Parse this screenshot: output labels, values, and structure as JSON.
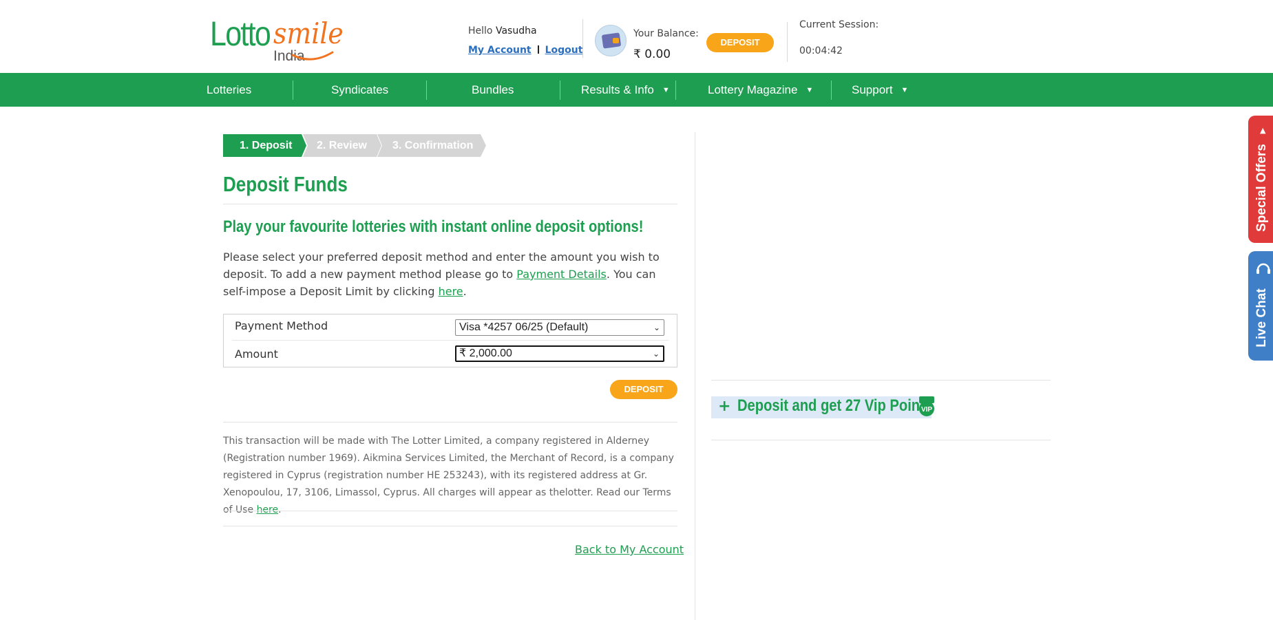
{
  "header": {
    "logo": {
      "part1": "Lotto",
      "part2": "smile",
      "part3": "India"
    },
    "greeting_prefix": "Hello",
    "username": "Vasudha",
    "my_account": "My Account",
    "logout": "Logout",
    "balance_label": "Your Balance:",
    "balance_value": "₹ 0.00",
    "deposit_button": "DEPOSIT",
    "session_label": "Current Session:",
    "session_time": "00:04:42"
  },
  "nav": {
    "items": [
      {
        "label": "Lotteries"
      },
      {
        "label": "Syndicates"
      },
      {
        "label": "Bundles"
      },
      {
        "label": "Results & Info",
        "arrow": "▼"
      },
      {
        "label": "Lottery Magazine",
        "arrow": "▼"
      },
      {
        "label": "Support",
        "arrow": "▼"
      }
    ]
  },
  "steps": [
    "1. Deposit",
    "2. Review",
    "3. Confirmation"
  ],
  "main": {
    "title": "Deposit Funds",
    "subtitle": "Play your favourite lotteries with instant online deposit options!",
    "intro": {
      "t1": "Please select your preferred deposit method and enter the amount you wish to deposit. To add a new payment method please go to ",
      "link1": "Payment Details",
      "t2": ". You can self-impose a Deposit Limit by clicking ",
      "link2": "here",
      "t3": "."
    },
    "form": {
      "payment_label": "Payment Method",
      "payment_value": "Visa *4257 06/25 (Default)",
      "amount_label": "Amount",
      "amount_value": "₹ 2,000.00"
    },
    "deposit_button": "DEPOSIT",
    "legal": {
      "text": "This transaction will be made with The Lotter Limited, a company registered in Alderney (Registration number 1969). Aikmina Services Limited, the Merchant of Record, is a company registered in Cyprus (registration number HE 253243), with its registered address at Gr. Xenopoulou, 17, 3106, Limassol, Cyprus. All charges will appear as thelotter. Read our Terms of Use ",
      "link": "here",
      "end": "."
    },
    "back_link": "Back to My Account"
  },
  "sidebar": {
    "vip_plus": "+",
    "vip_text": "Deposit and get 27 Vip Points",
    "vip_badge": "VIP"
  },
  "side_tabs": {
    "offers": "Special Offers",
    "offers_arrow": "▲",
    "chat": "Live Chat"
  },
  "colors": {
    "brand_green": "#1e9e50",
    "accent_orange": "#f9a51a",
    "offers_red": "#e03a3a",
    "chat_blue": "#3f7fc8"
  }
}
